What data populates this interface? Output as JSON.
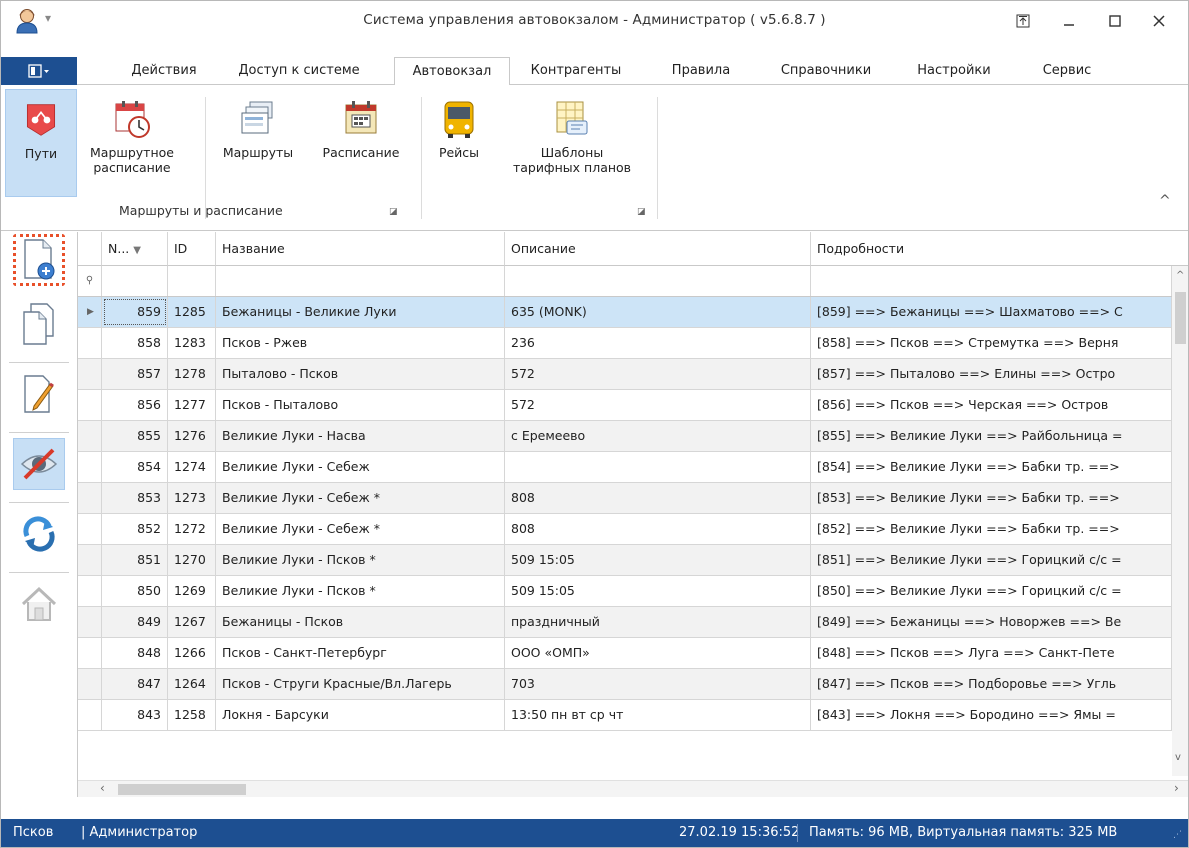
{
  "window": {
    "title": "Система управления автовокзалом - Администратор ( v5.6.8.7 )"
  },
  "tabs": [
    {
      "label": "Действия"
    },
    {
      "label": "Доступ к системе"
    },
    {
      "label": "Автовокзал"
    },
    {
      "label": "Контрагенты"
    },
    {
      "label": "Правила"
    },
    {
      "label": "Справочники"
    },
    {
      "label": "Настройки"
    },
    {
      "label": "Сервис"
    }
  ],
  "ribbon": {
    "paths": "Пути",
    "route_schedule_1": "Маршрутное",
    "route_schedule_2": "расписание",
    "routes": "Маршруты",
    "schedule": "Расписание",
    "trips": "Рейсы",
    "templates_1": "Шаблоны",
    "templates_2": "тарифных планов",
    "group_routes": "Маршруты и расписание"
  },
  "grid": {
    "columns": {
      "n": "N...",
      "id": "ID",
      "name": "Название",
      "desc": "Описание",
      "details": "Подробности"
    },
    "rows": [
      {
        "n": "859",
        "id": "1285",
        "name": "Бежаницы - Великие Луки",
        "desc": "635 (MONK)",
        "details": "[859]  ==> Бежаницы ==> Шахматово ==> С"
      },
      {
        "n": "858",
        "id": "1283",
        "name": "Псков - Ржев",
        "desc": "236",
        "details": "[858]  ==> Псков ==> Стремутка ==> Верня"
      },
      {
        "n": "857",
        "id": "1278",
        "name": "Пыталово - Псков",
        "desc": "572",
        "details": "[857]  ==> Пыталово ==> Елины ==> Остро"
      },
      {
        "n": "856",
        "id": "1277",
        "name": "Псков - Пыталово",
        "desc": "572",
        "details": "[856]  ==> Псков ==> Черская ==> Остров"
      },
      {
        "n": "855",
        "id": "1276",
        "name": "Великие Луки - Насва",
        "desc": "с Еремеево",
        "details": "[855]  ==> Великие Луки ==> Райбольница ="
      },
      {
        "n": "854",
        "id": "1274",
        "name": "Великие Луки - Себеж",
        "desc": "",
        "details": "[854]  ==> Великие Луки ==> Бабки тр. ==>"
      },
      {
        "n": "853",
        "id": "1273",
        "name": "Великие Луки - Себеж *",
        "desc": "808",
        "details": "[853]  ==> Великие Луки ==> Бабки тр. ==>"
      },
      {
        "n": "852",
        "id": "1272",
        "name": "Великие Луки - Себеж *",
        "desc": "808",
        "details": "[852]  ==> Великие Луки ==> Бабки тр. ==>"
      },
      {
        "n": "851",
        "id": "1270",
        "name": "Великие Луки - Псков *",
        "desc": "509 15:05",
        "details": "[851]  ==> Великие Луки ==> Горицкий с/с ="
      },
      {
        "n": "850",
        "id": "1269",
        "name": "Великие Луки - Псков *",
        "desc": "509 15:05",
        "details": "[850]  ==> Великие Луки ==> Горицкий с/с ="
      },
      {
        "n": "849",
        "id": "1267",
        "name": "Бежаницы - Псков",
        "desc": "праздничный",
        "details": "[849]  ==> Бежаницы ==> Новоржев ==> Ве"
      },
      {
        "n": "848",
        "id": "1266",
        "name": "Псков - Санкт-Петербург",
        "desc": "ООО «ОМП»",
        "details": "[848]  ==> Псков ==> Луга ==> Санкт-Пете"
      },
      {
        "n": "847",
        "id": "1264",
        "name": "Псков - Струги Красные/Вл.Лагерь",
        "desc": "703",
        "details": "[847]  ==> Псков ==> Подборовье ==> Угль"
      },
      {
        "n": "843",
        "id": "1258",
        "name": "Локня - Барсуки",
        "desc": "13:50 пн вт ср чт",
        "details": "[843]  ==> Локня ==> Бородино ==> Ямы ="
      }
    ]
  },
  "status": {
    "city": "Псков",
    "user": "| Администратор",
    "datetime": "27.02.19 15:36:52",
    "memory": "Память: 96 MB, Виртуальная память: 325 MB"
  },
  "colors": {
    "accent": "#1d4f91",
    "selected_row": "#cde4f7",
    "alt_row": "#f2f2f2"
  }
}
